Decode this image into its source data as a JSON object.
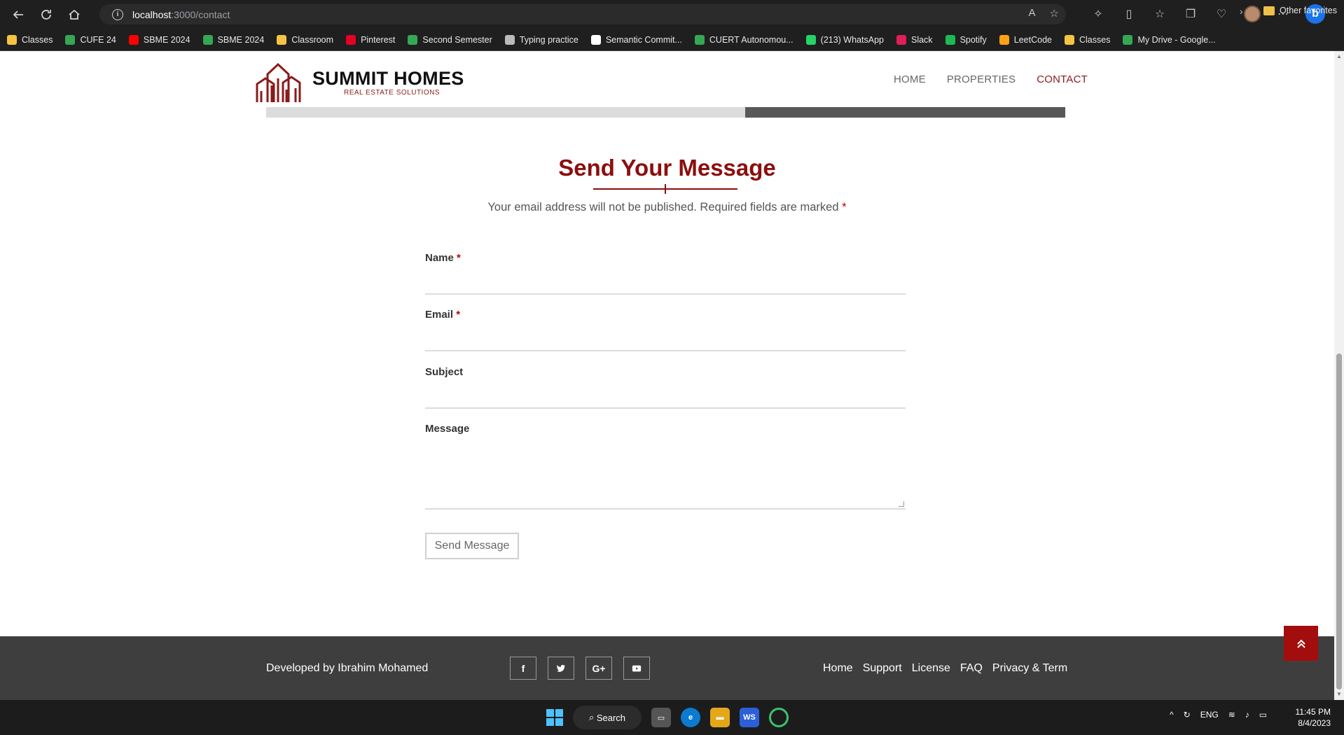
{
  "browser": {
    "url_host": "localhost",
    "url_rest": ":3000/contact",
    "bookmarks": [
      {
        "label": "Classes",
        "color": "#f6c342"
      },
      {
        "label": "CUFE 24",
        "color": "#34a853"
      },
      {
        "label": "SBME 2024",
        "color": "#ff0000"
      },
      {
        "label": "SBME 2024",
        "color": "#34a853"
      },
      {
        "label": "Classroom",
        "color": "#f6c342"
      },
      {
        "label": "Pinterest",
        "color": "#e60023"
      },
      {
        "label": "Second Semester",
        "color": "#34a853"
      },
      {
        "label": "Typing practice",
        "color": "#bbbbbb"
      },
      {
        "label": "Semantic Commit...",
        "color": "#ffffff"
      },
      {
        "label": "CUERT Autonomou...",
        "color": "#34a853"
      },
      {
        "label": "(213) WhatsApp",
        "color": "#25d366"
      },
      {
        "label": "Slack",
        "color": "#e01e5a"
      },
      {
        "label": "Spotify",
        "color": "#1db954"
      },
      {
        "label": "LeetCode",
        "color": "#ffa116"
      },
      {
        "label": "Classes",
        "color": "#f6c342"
      },
      {
        "label": "My Drive - Google...",
        "color": "#34a853"
      }
    ],
    "other_favorites": "Other favorites"
  },
  "site": {
    "brand": "SUMMIT HOMES",
    "tagline": "REAL ESTATE SOLUTIONS",
    "nav": [
      {
        "label": "HOME",
        "active": false
      },
      {
        "label": "PROPERTIES",
        "active": false
      },
      {
        "label": "CONTACT",
        "active": true
      }
    ],
    "accent": "#8b0e0e"
  },
  "form": {
    "title": "Send Your Message",
    "note": "Your email address will not be published. Required fields are marked",
    "required_mark": "*",
    "fields": {
      "name": "Name",
      "email": "Email",
      "subject": "Subject",
      "message": "Message"
    },
    "submit_label": "Send Message"
  },
  "footer": {
    "developer": "Developed by Ibrahim Mohamed",
    "social": [
      "f",
      "t",
      "G+",
      "yt"
    ],
    "links": [
      "Home",
      "Support",
      "License",
      "FAQ",
      "Privacy & Term"
    ]
  },
  "taskbar": {
    "search_label": "Search",
    "lang": "ENG",
    "time": "11:45 PM",
    "date": "8/4/2023"
  }
}
